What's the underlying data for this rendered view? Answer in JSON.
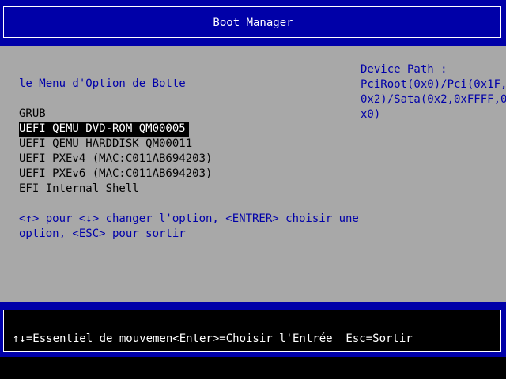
{
  "header": {
    "title": "Boot Manager"
  },
  "menu": {
    "heading": "le Menu d'Option de Botte",
    "items": [
      "GRUB",
      "UEFI QEMU DVD-ROM QM00005",
      "UEFI QEMU HARDDISK QM00011",
      "UEFI PXEv4 (MAC:C011AB694203)",
      "UEFI PXEv6 (MAC:C011AB694203)",
      "EFI Internal Shell"
    ],
    "selected_index": 1,
    "instructions_line1": "<↑> pour <↓> changer l'option, <ENTRER> choisir une",
    "instructions_line2": "option, <ESC> pour sortir"
  },
  "device_path": {
    "label": "Device Path :",
    "line1": "PciRoot(0x0)/Pci(0x1F,",
    "line2": "0x2)/Sata(0x2,0xFFFF,0",
    "line3": "x0)"
  },
  "footer": {
    "help": "↑↓=Essentiel de mouvemen<Enter>=Choisir l'Entrée  Esc=Sortir"
  },
  "colors": {
    "bar": "#0000a8",
    "body": "#a8a8a8",
    "text": "#0000a8",
    "selected_bg": "#000000",
    "selected_fg": "#ffffff"
  }
}
